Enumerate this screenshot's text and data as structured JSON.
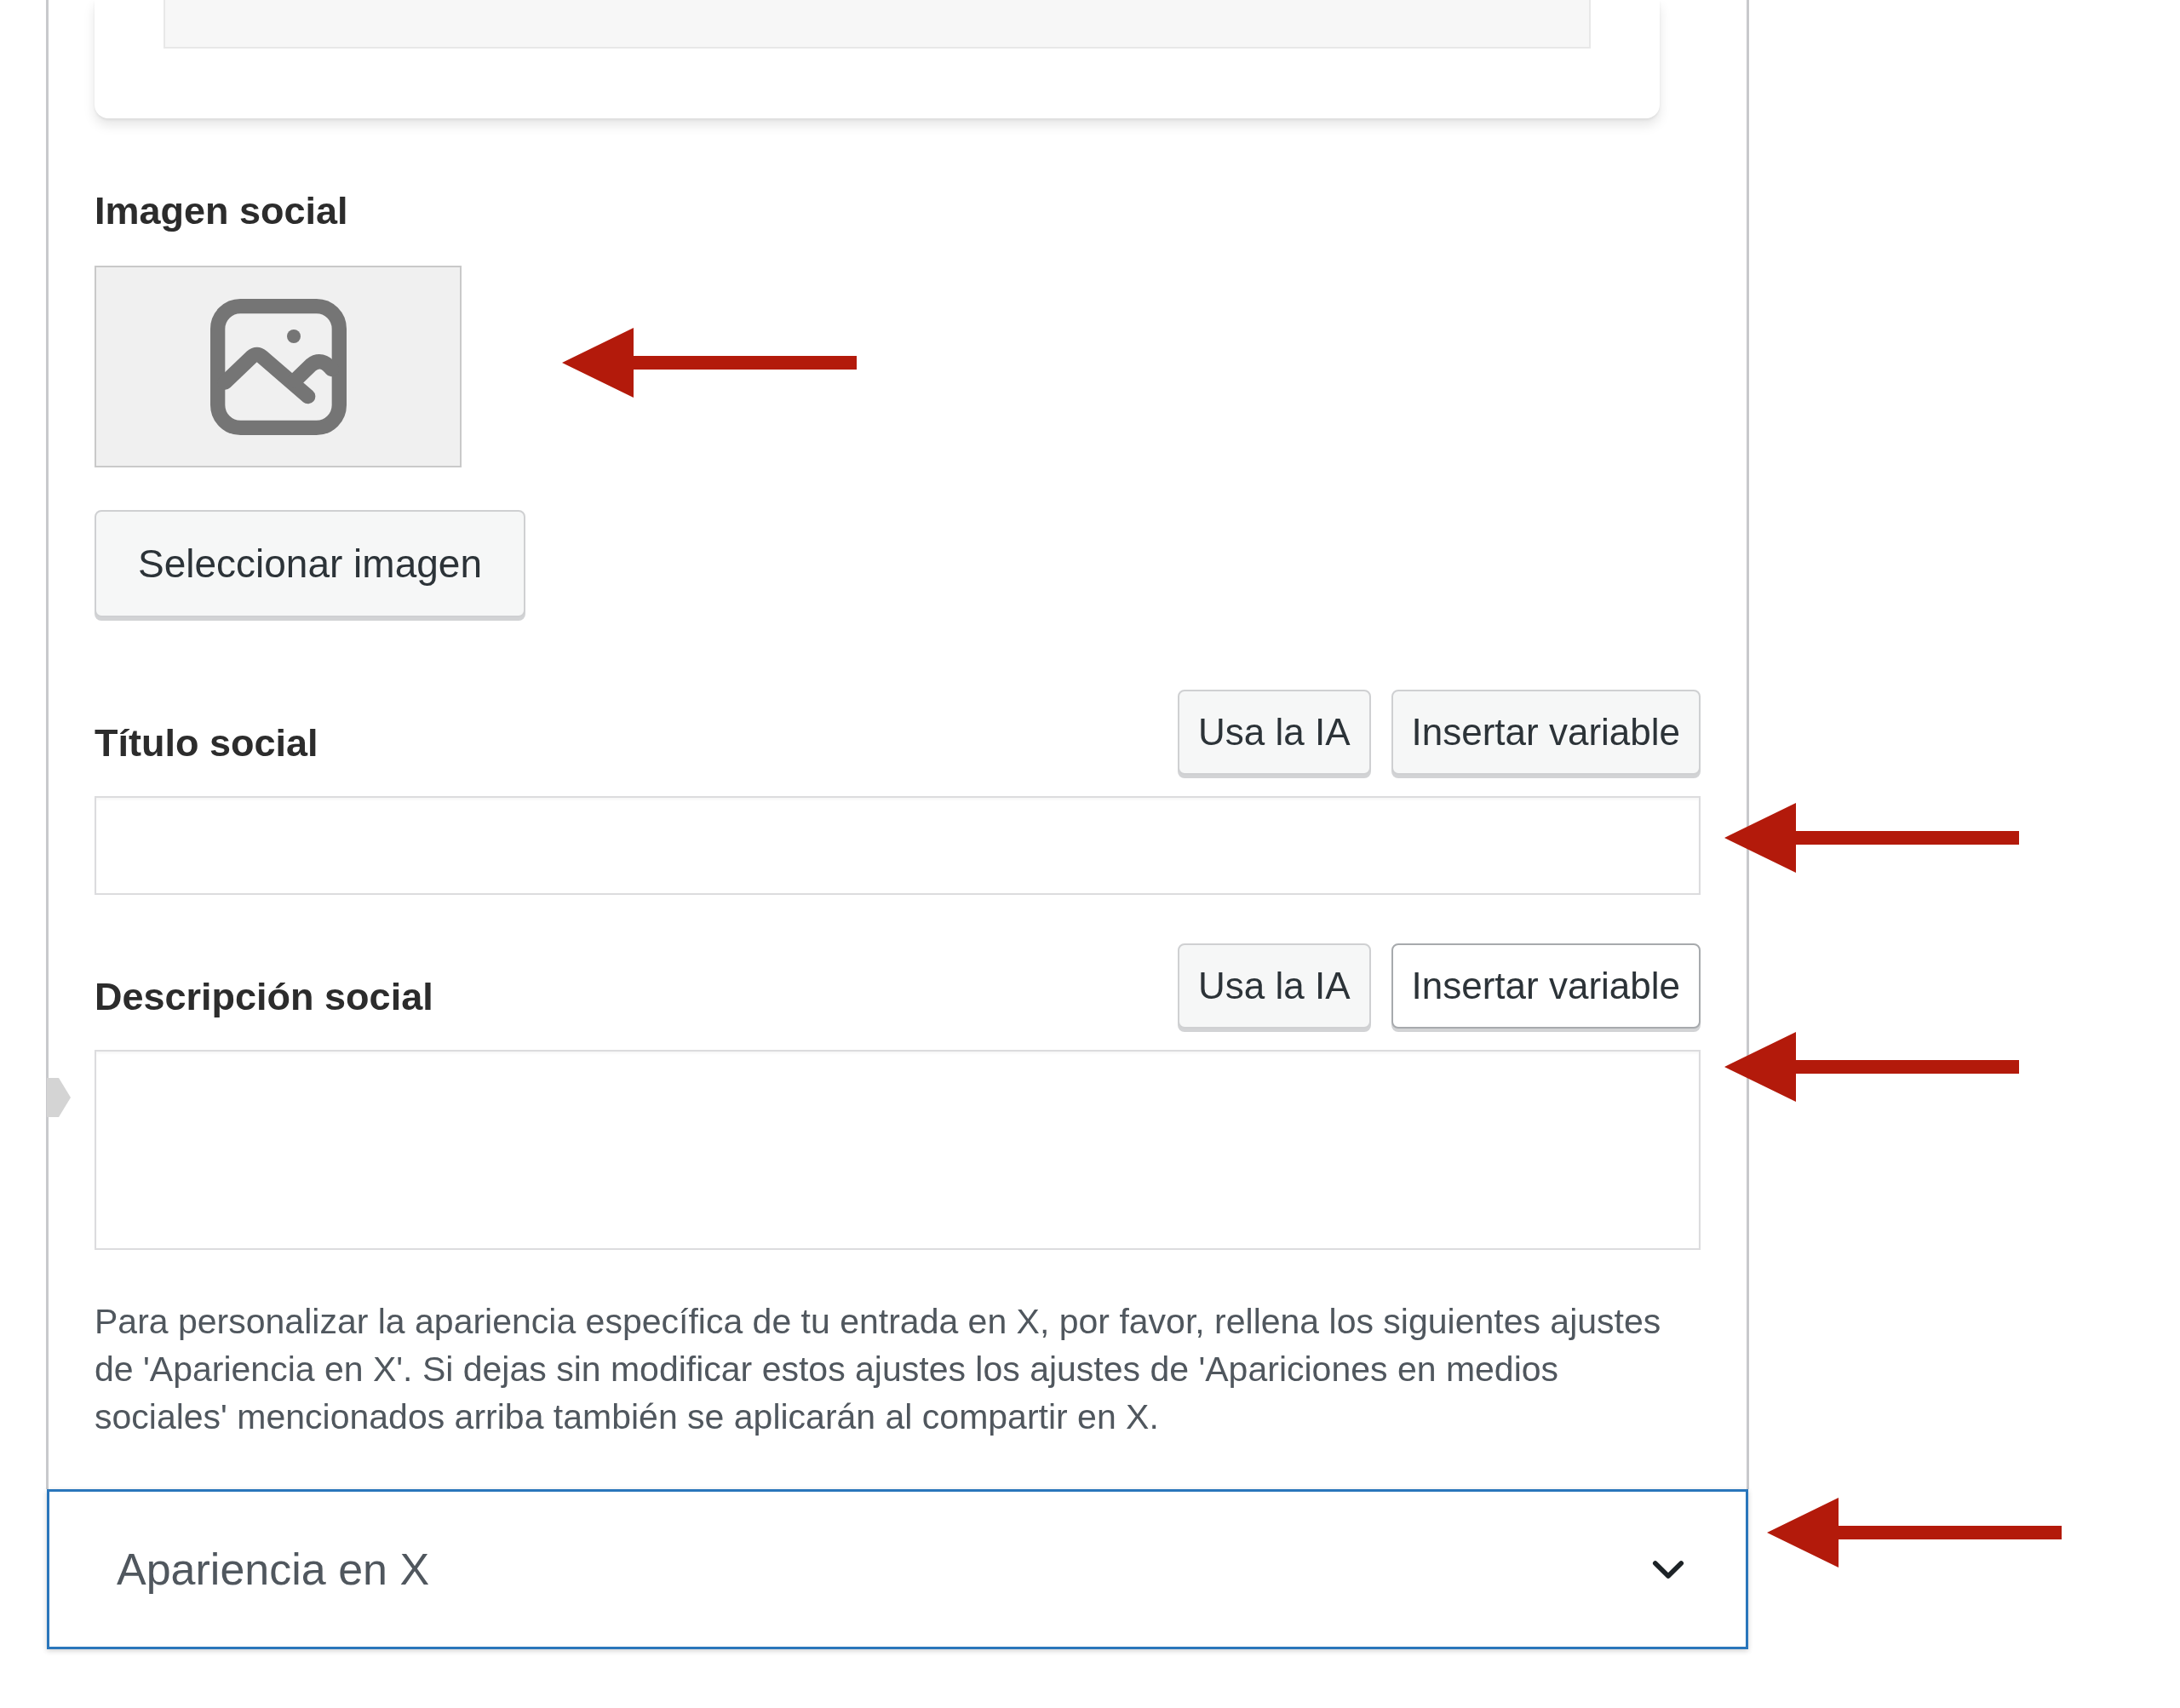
{
  "social_image": {
    "label": "Imagen social",
    "annotation_arrow": true,
    "button": "Seleccionar imagen"
  },
  "fields": [
    {
      "kind": "input",
      "label": "Título social",
      "annotation_arrow": true,
      "buttons": [
        {
          "label": "Usa la IA",
          "hovered": false
        },
        {
          "label": "Insertar variable",
          "hovered": false
        }
      ]
    },
    {
      "kind": "textarea",
      "label": "Descripción social",
      "annotation_arrow": true,
      "buttons": [
        {
          "label": "Usa la IA",
          "hovered": false
        },
        {
          "label": "Insertar variable",
          "hovered": true
        }
      ]
    }
  ],
  "help_text": "Para personalizar la apariencia específica de tu entrada en X, por favor, rellena los siguientes ajustes de 'Apariencia en X'. Si dejas sin modificar estos ajustes los ajustes de 'Apariciones en medios sociales' mencionados arriba también se aplicarán al compartir en X.",
  "accordion": {
    "title": "Apariencia en X",
    "expanded": false,
    "focused": true,
    "annotation_arrow": true
  }
}
